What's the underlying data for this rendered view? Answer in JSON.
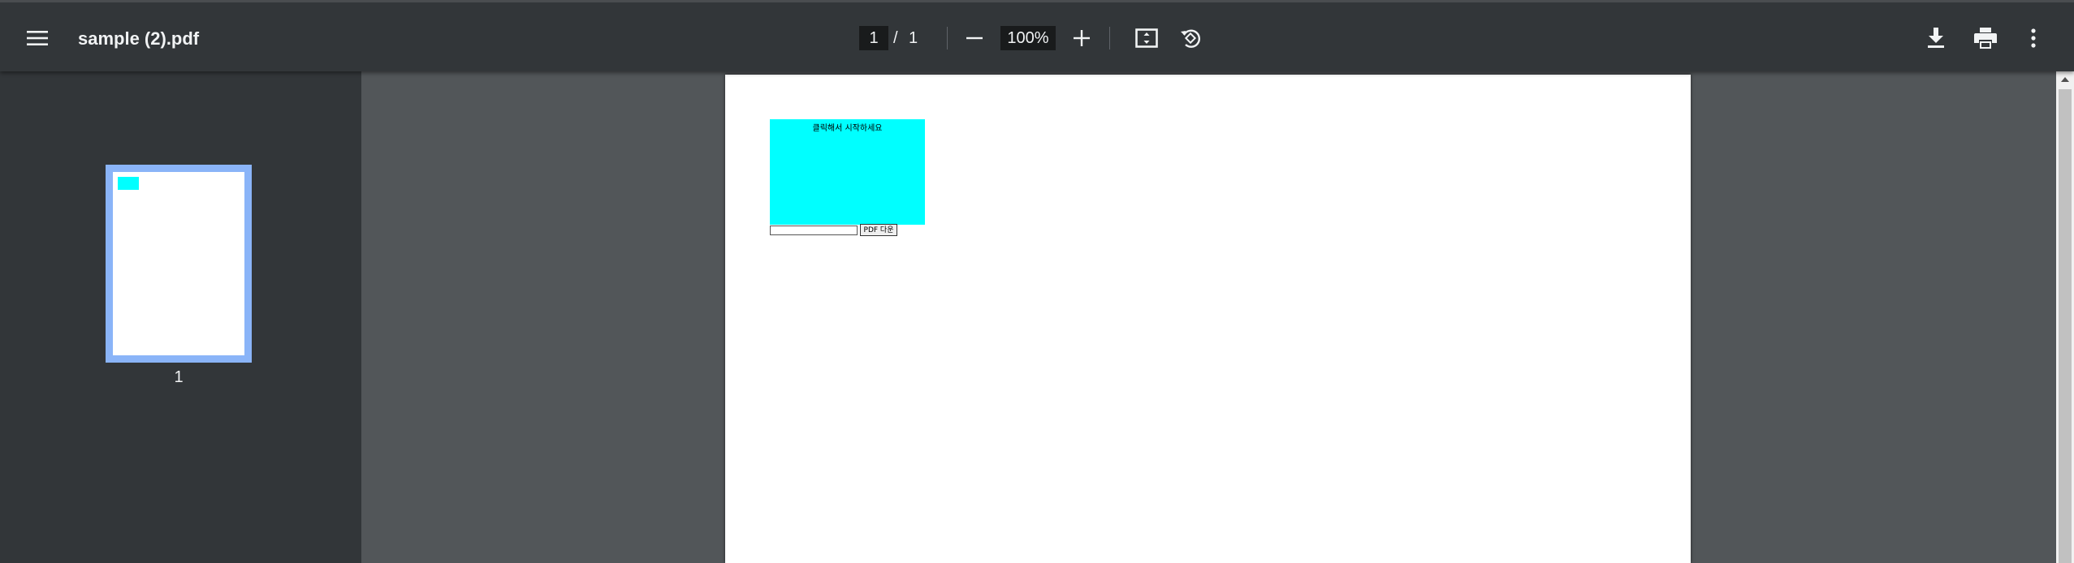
{
  "toolbar": {
    "menu_icon": "hamburger-menu-icon",
    "title": "sample (2).pdf",
    "page_current": "1",
    "page_separator": "/",
    "page_total": "1",
    "zoom_out_icon": "minus-icon",
    "zoom_value": "100%",
    "zoom_in_icon": "plus-icon",
    "fit_icon": "fit-to-page-icon",
    "rotate_icon": "rotate-counterclockwise-icon",
    "download_icon": "download-icon",
    "print_icon": "print-icon",
    "more_icon": "more-vertical-icon"
  },
  "sidebar": {
    "thumbnails": [
      {
        "page_number": "1"
      }
    ]
  },
  "document": {
    "cyan_box_text": "클릭해서 시작하세요",
    "input_value": "",
    "button_label": "PDF 다운"
  },
  "colors": {
    "toolbar_bg": "#323639",
    "viewer_bg": "#525659",
    "thumbnail_highlight": "#8ab4f8",
    "cyan_box": "#00ffff"
  }
}
